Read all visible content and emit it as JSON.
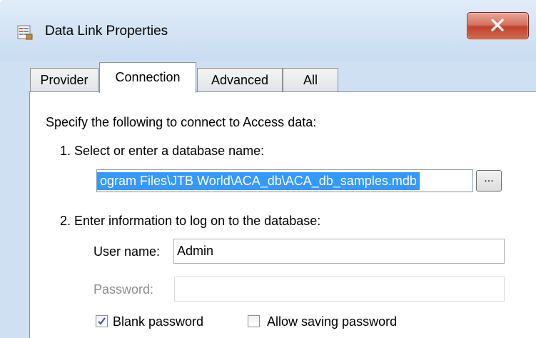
{
  "window": {
    "title": "Data Link Properties",
    "icon": "data-link-icon",
    "close_icon": "close-x-icon"
  },
  "tabs": [
    {
      "label": "Provider"
    },
    {
      "label": "Connection"
    },
    {
      "label": "Advanced"
    },
    {
      "label": "All"
    }
  ],
  "active_tab": "Connection",
  "connection": {
    "intro": "Specify the following to connect to Access data:",
    "step1_label": "1. Select or enter a database name:",
    "database_path": "ogram Files\\JTB World\\ACA_db\\ACA_db_samples.mdb",
    "browse_label": "...",
    "step2_label": "2. Enter information to log on to the database:",
    "username_label": "User name:",
    "username_value": "Admin",
    "password_label": "Password:",
    "password_value": "",
    "blank_password_label": "Blank password",
    "blank_password_checked": true,
    "allow_saving_label": "Allow saving password",
    "allow_saving_checked": false
  },
  "colors": {
    "title_bar": "#cfe0f3",
    "close_button": "#c1432b",
    "selection": "#3399ff"
  }
}
